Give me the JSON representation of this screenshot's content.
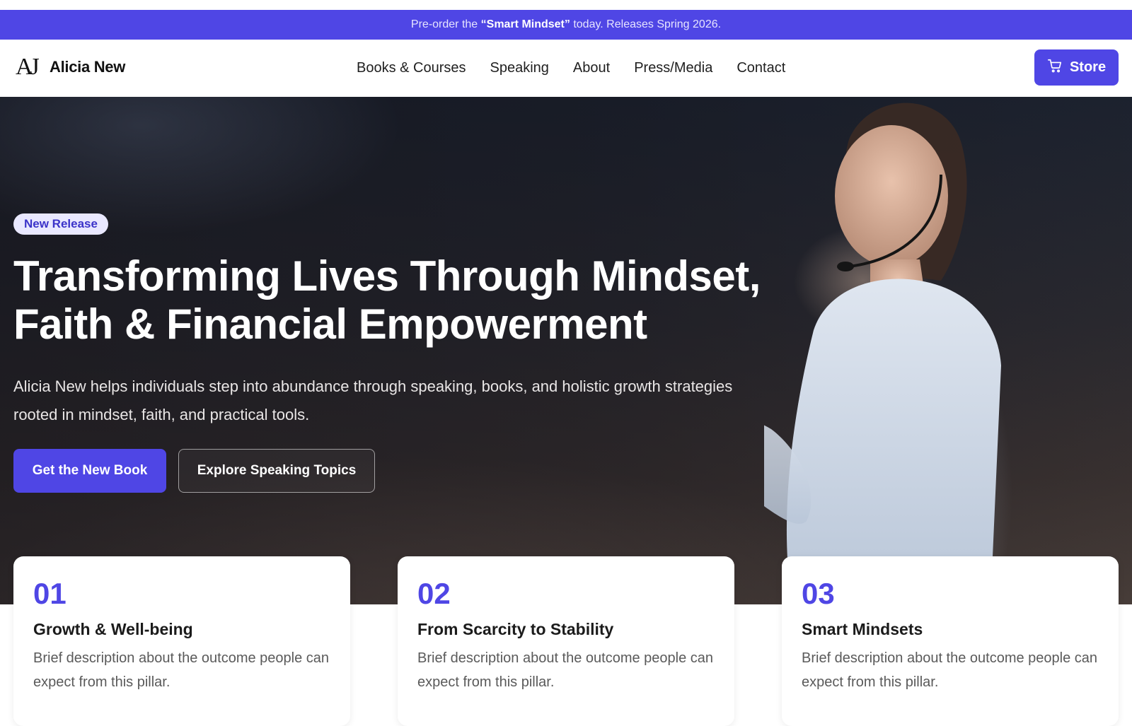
{
  "announcement": {
    "prefix": "Pre-order the ",
    "highlight": "“Smart Mindset”",
    "suffix": " today. Releases Spring 2026."
  },
  "brand": {
    "mark": "AJ",
    "name": "Alicia New"
  },
  "nav": {
    "items": [
      {
        "label": "Books & Courses"
      },
      {
        "label": "Speaking"
      },
      {
        "label": "About"
      },
      {
        "label": "Press/Media"
      },
      {
        "label": "Contact"
      }
    ],
    "store_label": "Store"
  },
  "hero": {
    "badge": "New Release",
    "headline_line1": "Transforming Lives Through Mindset,",
    "headline_line2": "Faith & Financial Empowerment",
    "subheading": "Alicia New helps individuals step into abundance through speaking, books, and holistic growth strategies rooted in mindset, faith, and practical tools.",
    "primary_cta": "Get the New Book",
    "secondary_cta": "Explore Speaking Topics"
  },
  "pillars": [
    {
      "number": "01",
      "title": "Growth & Well-being",
      "description": "Brief description about the outcome people can expect from this pillar."
    },
    {
      "number": "02",
      "title": "From Scarcity to Stability",
      "description": "Brief description about the outcome people can expect from this pillar."
    },
    {
      "number": "03",
      "title": "Smart Mindsets",
      "description": "Brief description about the outcome people can expect from this pillar."
    }
  ],
  "colors": {
    "accent": "#4f46e5",
    "badge_bg": "#e9e8ff"
  },
  "icons": {
    "store": "cart-icon"
  }
}
